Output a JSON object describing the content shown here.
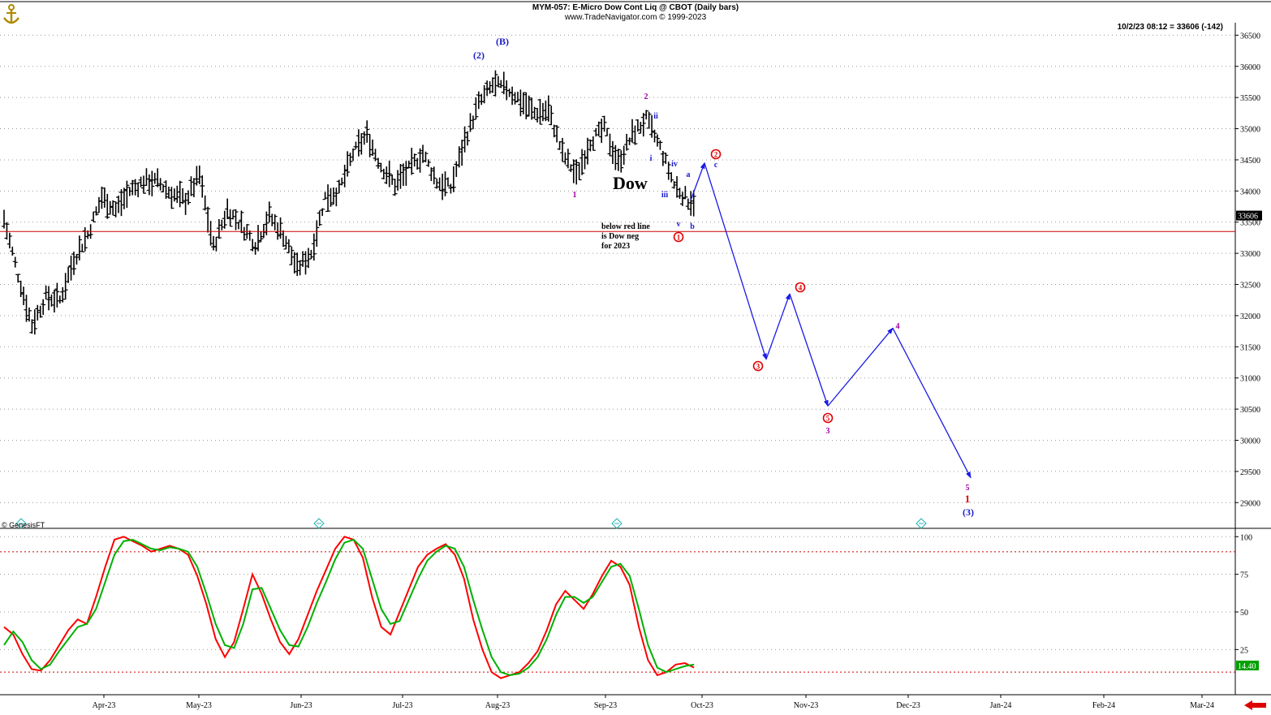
{
  "header": {
    "title": "MYM-057:  E-Micro Dow Cont Liq @ CBOT  (Daily bars)",
    "subtitle": "www.TradeNavigator.com © 1999-2023",
    "quote": "10/2/23 08:12 = 33606 (-142)",
    "copyright": "© GenesisFT"
  },
  "colors": {
    "bars": "#000000",
    "redline": "#cc0000",
    "projection": "#1a1ae6",
    "fast": "#ff0000",
    "slow": "#00b000",
    "wave_blue": "#1a1acc",
    "wave_purple": "#a000a0",
    "wave_red": "#e00000",
    "last_price_bg": "#000000",
    "osc_value_bg": "#00a000"
  },
  "chart_data": [
    {
      "type": "ohlc",
      "name": "price",
      "y_axis_ticks": [
        "36500",
        "36000",
        "35500",
        "35000",
        "34500",
        "34000",
        "33500",
        "33000",
        "32500",
        "32000",
        "31500",
        "31000",
        "30500",
        "30000",
        "29500",
        "29000"
      ],
      "ylim": [
        28600,
        36700
      ],
      "x_axis_ticks": [
        "Apr-23",
        "May-23",
        "Jun-23",
        "Jul-23",
        "Aug-23",
        "Sep-23",
        "Oct-23",
        "Nov-23",
        "Dec-23",
        "Jan-24",
        "Feb-24",
        "Mar-24"
      ],
      "last_price": "33606",
      "reference_line": 33350,
      "price_path": [
        [
          0,
          33550
        ],
        [
          5,
          32650
        ],
        [
          10,
          31850
        ],
        [
          15,
          32300
        ],
        [
          20,
          32250
        ],
        [
          25,
          32900
        ],
        [
          30,
          33300
        ],
        [
          35,
          33900
        ],
        [
          40,
          33700
        ],
        [
          45,
          34000
        ],
        [
          50,
          34150
        ],
        [
          55,
          34150
        ],
        [
          60,
          33950
        ],
        [
          65,
          33850
        ],
        [
          70,
          34250
        ],
        [
          75,
          33100
        ],
        [
          80,
          33700
        ],
        [
          85,
          33450
        ],
        [
          90,
          33150
        ],
        [
          95,
          33600
        ],
        [
          100,
          33300
        ],
        [
          105,
          32750
        ],
        [
          110,
          33000
        ],
        [
          115,
          33900
        ],
        [
          120,
          34000
        ],
        [
          125,
          34600
        ],
        [
          130,
          34900
        ],
        [
          135,
          34400
        ],
        [
          140,
          34100
        ],
        [
          145,
          34350
        ],
        [
          150,
          34600
        ],
        [
          155,
          34150
        ],
        [
          160,
          34050
        ],
        [
          165,
          34800
        ],
        [
          170,
          35400
        ],
        [
          175,
          35700
        ],
        [
          180,
          35650
        ],
        [
          185,
          35450
        ],
        [
          190,
          35250
        ],
        [
          195,
          35300
        ],
        [
          200,
          34600
        ],
        [
          205,
          34250
        ],
        [
          210,
          34800
        ],
        [
          215,
          35000
        ],
        [
          220,
          34450
        ],
        [
          225,
          34900
        ],
        [
          230,
          35150
        ],
        [
          235,
          34700
        ],
        [
          240,
          34100
        ],
        [
          245,
          33850
        ]
      ],
      "projection": [
        {
          "x": "Oct-23",
          "y": 34450
        },
        {
          "x": "Oct-23",
          "y": 31300
        },
        {
          "x": "Nov-23",
          "y": 32350
        },
        {
          "x": "Nov-23",
          "y": 30550
        },
        {
          "x": "Dec-23",
          "y": 31800
        },
        {
          "x": "Jan-24",
          "y": 29400
        }
      ],
      "annotations": [
        {
          "text": "(B)",
          "x": 619,
          "y": 55,
          "color": "#1a1acc",
          "size": 12
        },
        {
          "text": "(2)",
          "x": 590,
          "y": 72,
          "color": "#1a1acc",
          "size": 12
        },
        {
          "text": "2",
          "x": 796,
          "y": 122,
          "color": "#a000a0",
          "size": 10
        },
        {
          "text": "ii",
          "x": 808,
          "y": 146,
          "color": "#1a1acc",
          "size": 10
        },
        {
          "text": "i",
          "x": 802,
          "y": 198,
          "color": "#1a1acc",
          "size": 10
        },
        {
          "text": "iv",
          "x": 831,
          "y": 205,
          "color": "#1a1acc",
          "size": 10
        },
        {
          "text": "a",
          "x": 848,
          "y": 218,
          "color": "#1a1acc",
          "size": 10
        },
        {
          "text": "iii",
          "x": 819,
          "y": 243,
          "color": "#1a1acc",
          "size": 10
        },
        {
          "text": "1",
          "x": 708,
          "y": 243,
          "color": "#a000a0",
          "size": 10
        },
        {
          "text": "v",
          "x": 836,
          "y": 279,
          "color": "#1a1acc",
          "size": 10
        },
        {
          "text": "b",
          "x": 853,
          "y": 282,
          "color": "#1a1acc",
          "size": 10
        },
        {
          "text": "c",
          "x": 882,
          "y": 206,
          "color": "#1a1acc",
          "size": 10
        },
        {
          "text": "3",
          "x": 1020,
          "y": 534,
          "color": "#a000a0",
          "size": 10
        },
        {
          "text": "4",
          "x": 1106,
          "y": 405,
          "color": "#a000a0",
          "size": 10
        },
        {
          "text": "5",
          "x": 1192,
          "y": 604,
          "color": "#a000a0",
          "size": 10
        },
        {
          "text": "1",
          "x": 1192,
          "y": 619,
          "color": "#e00000",
          "size": 13
        },
        {
          "text": "(3)",
          "x": 1193,
          "y": 635,
          "color": "#1a1acc",
          "size": 12
        }
      ],
      "circled_labels": [
        {
          "text": "1",
          "x": 836,
          "y": 292
        },
        {
          "text": "2",
          "x": 882,
          "y": 190
        },
        {
          "text": "3",
          "x": 934,
          "y": 451
        },
        {
          "text": "4",
          "x": 986,
          "y": 354
        },
        {
          "text": "5",
          "x": 1020,
          "y": 515
        }
      ],
      "big_label": "Dow",
      "note_lines": [
        "below red line",
        "is Dow neg",
        "for 2023"
      ],
      "cycle_markers": [
        26,
        393,
        760,
        1135
      ]
    },
    {
      "type": "line",
      "name": "oscillator",
      "y_axis_ticks": [
        "100",
        "75",
        "50",
        "25"
      ],
      "ylim": [
        0,
        100
      ],
      "last_value": "14.40",
      "fast_path": [
        [
          0,
          40
        ],
        [
          5,
          35
        ],
        [
          10,
          22
        ],
        [
          15,
          12
        ],
        [
          20,
          11
        ],
        [
          25,
          18
        ],
        [
          30,
          28
        ],
        [
          35,
          38
        ],
        [
          40,
          45
        ],
        [
          45,
          42
        ],
        [
          50,
          60
        ],
        [
          55,
          80
        ],
        [
          60,
          98
        ],
        [
          65,
          100
        ],
        [
          70,
          97
        ],
        [
          75,
          94
        ],
        [
          80,
          90
        ],
        [
          85,
          92
        ],
        [
          90,
          94
        ],
        [
          95,
          92
        ],
        [
          100,
          88
        ],
        [
          105,
          74
        ],
        [
          110,
          55
        ],
        [
          115,
          32
        ],
        [
          120,
          20
        ],
        [
          125,
          30
        ],
        [
          130,
          52
        ],
        [
          135,
          75
        ],
        [
          140,
          62
        ],
        [
          145,
          45
        ],
        [
          150,
          30
        ],
        [
          155,
          22
        ],
        [
          160,
          32
        ],
        [
          165,
          48
        ],
        [
          170,
          64
        ],
        [
          175,
          78
        ],
        [
          180,
          92
        ],
        [
          185,
          100
        ],
        [
          190,
          98
        ],
        [
          195,
          86
        ],
        [
          200,
          60
        ],
        [
          205,
          40
        ],
        [
          210,
          35
        ],
        [
          215,
          50
        ],
        [
          220,
          65
        ],
        [
          225,
          80
        ],
        [
          230,
          88
        ],
        [
          235,
          92
        ],
        [
          240,
          95
        ],
        [
          245,
          88
        ],
        [
          250,
          72
        ],
        [
          255,
          45
        ],
        [
          260,
          25
        ],
        [
          265,
          10
        ],
        [
          270,
          6
        ],
        [
          275,
          8
        ],
        [
          280,
          10
        ],
        [
          285,
          16
        ],
        [
          290,
          24
        ],
        [
          295,
          38
        ],
        [
          300,
          55
        ],
        [
          305,
          64
        ],
        [
          310,
          58
        ],
        [
          315,
          52
        ],
        [
          320,
          62
        ],
        [
          325,
          74
        ],
        [
          330,
          84
        ],
        [
          335,
          80
        ],
        [
          340,
          68
        ],
        [
          345,
          40
        ],
        [
          350,
          18
        ],
        [
          355,
          8
        ],
        [
          360,
          10
        ],
        [
          365,
          15
        ],
        [
          370,
          16
        ],
        [
          375,
          13
        ]
      ],
      "slow_path": [
        [
          0,
          28
        ],
        [
          5,
          37
        ],
        [
          10,
          30
        ],
        [
          15,
          18
        ],
        [
          20,
          12
        ],
        [
          25,
          15
        ],
        [
          30,
          24
        ],
        [
          35,
          32
        ],
        [
          40,
          40
        ],
        [
          45,
          42
        ],
        [
          50,
          52
        ],
        [
          55,
          70
        ],
        [
          60,
          88
        ],
        [
          65,
          97
        ],
        [
          70,
          98
        ],
        [
          75,
          95
        ],
        [
          80,
          92
        ],
        [
          85,
          91
        ],
        [
          90,
          93
        ],
        [
          95,
          92
        ],
        [
          100,
          90
        ],
        [
          105,
          80
        ],
        [
          110,
          62
        ],
        [
          115,
          42
        ],
        [
          120,
          28
        ],
        [
          125,
          26
        ],
        [
          130,
          42
        ],
        [
          135,
          65
        ],
        [
          140,
          66
        ],
        [
          145,
          52
        ],
        [
          150,
          38
        ],
        [
          155,
          28
        ],
        [
          160,
          27
        ],
        [
          165,
          40
        ],
        [
          170,
          56
        ],
        [
          175,
          70
        ],
        [
          180,
          85
        ],
        [
          185,
          96
        ],
        [
          190,
          98
        ],
        [
          195,
          92
        ],
        [
          200,
          72
        ],
        [
          205,
          52
        ],
        [
          210,
          42
        ],
        [
          215,
          44
        ],
        [
          220,
          58
        ],
        [
          225,
          72
        ],
        [
          230,
          84
        ],
        [
          235,
          90
        ],
        [
          240,
          94
        ],
        [
          245,
          92
        ],
        [
          250,
          80
        ],
        [
          255,
          58
        ],
        [
          260,
          38
        ],
        [
          265,
          20
        ],
        [
          270,
          10
        ],
        [
          275,
          8
        ],
        [
          280,
          9
        ],
        [
          285,
          13
        ],
        [
          290,
          20
        ],
        [
          295,
          32
        ],
        [
          300,
          48
        ],
        [
          305,
          60
        ],
        [
          310,
          60
        ],
        [
          315,
          56
        ],
        [
          320,
          60
        ],
        [
          325,
          70
        ],
        [
          330,
          80
        ],
        [
          335,
          82
        ],
        [
          340,
          74
        ],
        [
          345,
          52
        ],
        [
          350,
          28
        ],
        [
          355,
          13
        ],
        [
          360,
          10
        ],
        [
          365,
          12
        ],
        [
          370,
          14
        ],
        [
          375,
          15
        ]
      ],
      "overbought": 90,
      "oversold": 10
    }
  ]
}
